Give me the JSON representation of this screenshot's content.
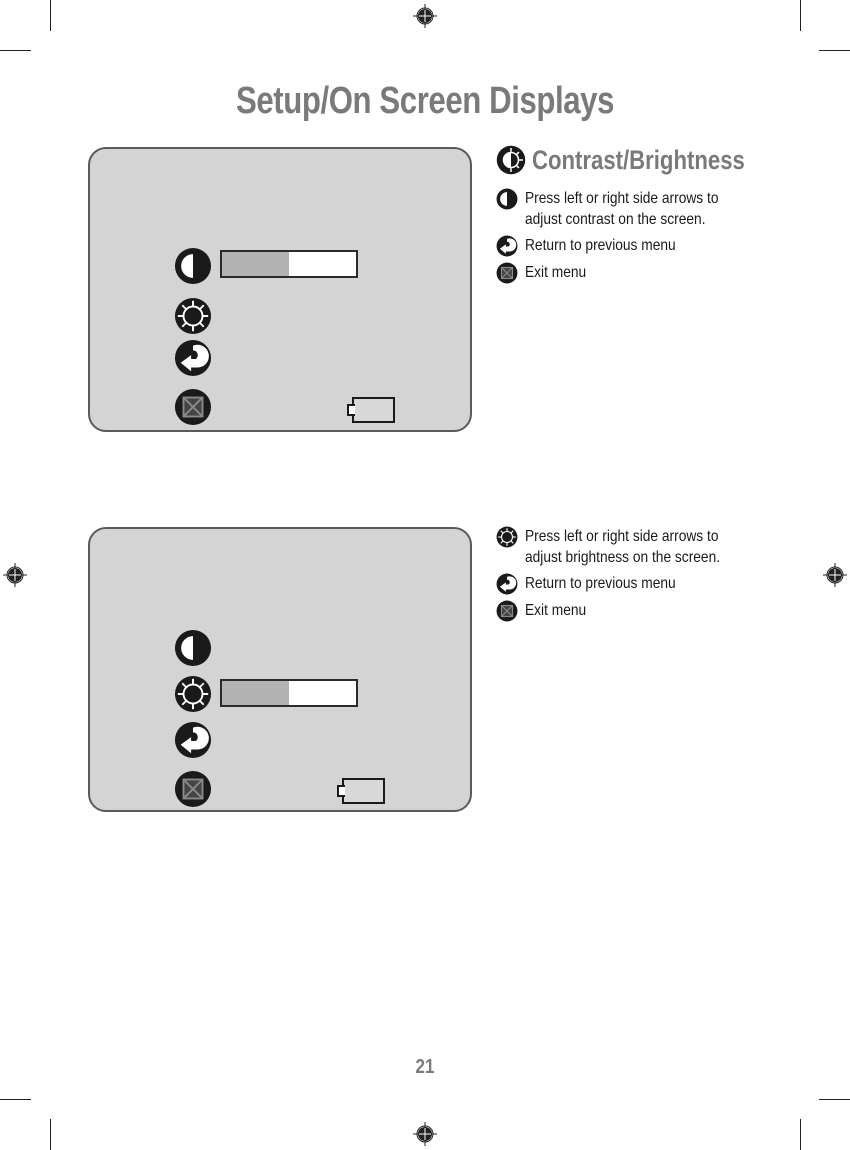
{
  "page": {
    "title": "Setup/On Screen Displays",
    "page_number": "21"
  },
  "colors": {
    "title_gray": "#7a7a7a",
    "panel_fill": "#d4d4d4",
    "panel_border": "#5a5a5a",
    "bar_fill": "#b3b3b3",
    "icon_dark": "#1a1a1a"
  },
  "sections": [
    {
      "heading": {
        "icon": "contrast-brightness-icon",
        "label": "Contrast/Brightness"
      },
      "osd_panel": {
        "menu_icons": [
          "contrast-icon",
          "brightness-icon",
          "return-icon",
          "exit-icon"
        ],
        "active_item": "contrast",
        "slider_level_percent": 50,
        "battery_icon": "battery-icon"
      },
      "items": [
        {
          "icon": "contrast-icon",
          "text_line1": "Press left or right side arrows to",
          "text_line2": "adjust contrast on the screen."
        },
        {
          "icon": "return-icon",
          "text_line1": "Return to previous menu"
        },
        {
          "icon": "exit-icon",
          "text_line1": "Exit menu"
        }
      ]
    },
    {
      "osd_panel": {
        "menu_icons": [
          "contrast-icon",
          "brightness-icon",
          "return-icon",
          "exit-icon"
        ],
        "active_item": "brightness",
        "slider_level_percent": 50,
        "battery_icon": "battery-icon"
      },
      "items": [
        {
          "icon": "brightness-icon",
          "text_line1": "Press left or right side arrows to",
          "text_line2": "adjust brightness on the screen."
        },
        {
          "icon": "return-icon",
          "text_line1": "Return to previous menu"
        },
        {
          "icon": "exit-icon",
          "text_line1": "Exit menu"
        }
      ]
    }
  ]
}
